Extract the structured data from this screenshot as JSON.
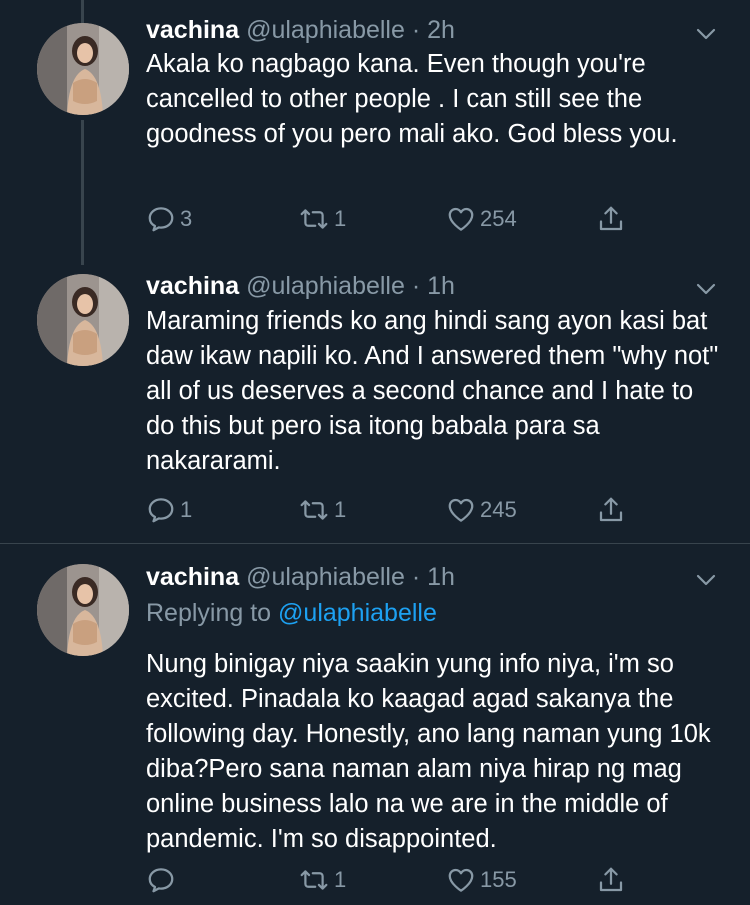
{
  "tweets": [
    {
      "name": "vachina",
      "handle": "@ulaphiabelle",
      "dot": " · ",
      "time": "2h",
      "text": "Akala ko nagbago kana. Even though you're cancelled to other people . I can still see the goodness of you pero mali ako. God bless you.",
      "replies": "3",
      "retweets": "1",
      "likes": "254"
    },
    {
      "name": "vachina",
      "handle": "@ulaphiabelle",
      "dot": " · ",
      "time": "1h",
      "text": "Maraming friends ko ang hindi sang ayon kasi bat daw ikaw napili ko. And I answered them \"why not\" all of us deserves a second chance and I hate to do this but pero isa itong babala para sa nakararami.",
      "replies": "1",
      "retweets": "1",
      "likes": "245"
    },
    {
      "name": "vachina",
      "handle": "@ulaphiabelle",
      "dot": " · ",
      "time": "1h",
      "replying_prefix": "Replying to ",
      "replying_to": "@ulaphiabelle",
      "text": "Nung binigay niya saakin yung info niya, i'm so excited. Pinadala ko kaagad agad sakanya the following day. Honestly, ano lang naman yung 10k diba?Pero sana naman alam niya hirap ng mag online business lalo na we are in the middle of pandemic. I'm so disappointed.",
      "replies": "",
      "retweets": "1",
      "likes": "155"
    }
  ],
  "icons": {
    "reply": "reply-icon",
    "retweet": "retweet-icon",
    "like": "heart-icon",
    "share": "share-icon",
    "more": "chevron-down-icon"
  },
  "colors": {
    "background": "#15202b",
    "text": "#ffffff",
    "muted": "#8899a6",
    "link": "#1da1f2",
    "divider": "#38444d"
  }
}
